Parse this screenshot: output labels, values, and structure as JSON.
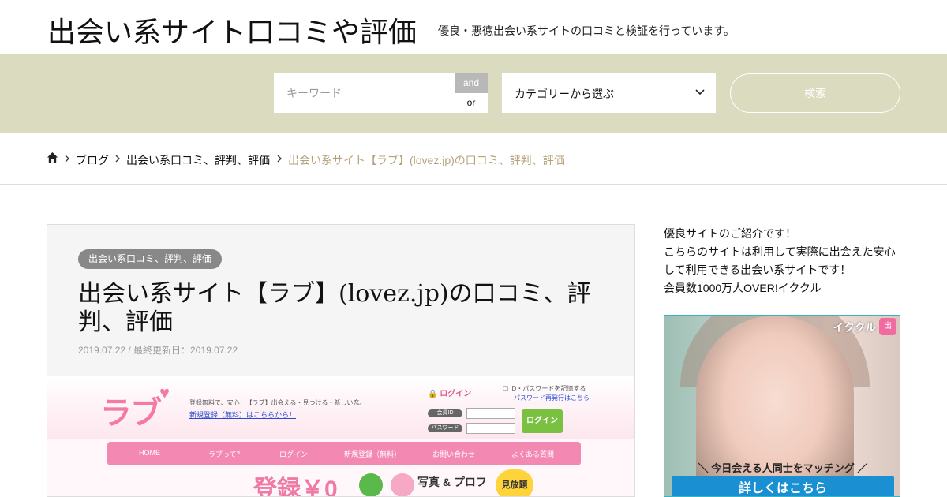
{
  "header": {
    "site_title": "出会い系サイト口コミや評価",
    "site_description": "優良・悪徳出会い系サイトの口コミと検証を行っています。"
  },
  "search": {
    "keyword_placeholder": "キーワード",
    "keyword_value": "",
    "and_label": "and",
    "or_label": "or",
    "category_selected": "カテゴリーから選ぶ",
    "search_button": "検索"
  },
  "breadcrumb": {
    "items": [
      "ブログ",
      "出会い系口コミ、評判、評価"
    ],
    "current": "出会い系サイト【ラブ】(lovez.jp)の口コミ、評判、評価"
  },
  "article": {
    "category_badge": "出会い系口コミ、評判、評価",
    "title": "出会い系サイト【ラブ】(lovez.jp)の口コミ、評判、評価",
    "date_line": "2019.07.22 / 最終更新日：2019.07.22"
  },
  "hero": {
    "logo": "ラブ",
    "tagline": "登録無料で、安心！【ラブ】出会える・見つける・新しい恋。",
    "register_link": "新規登録（無料）はこちらから！",
    "login_label": "ログイン",
    "remember_label": "ID・パスワードを記憶する",
    "password_reissue": "パスワード再発行はこちら",
    "member_id_label": "会員ID",
    "password_label": "パスワード",
    "login_button": "ログイン",
    "nav": [
      "HOME",
      "ラブって？",
      "ログイン",
      "新規登録（無料）",
      "お問い合わせ",
      "よくある質問"
    ],
    "reg_free": "登録￥0",
    "photo_profile": "写真 & プロフ",
    "unlimited": "見放題"
  },
  "sidebar": {
    "lines": [
      "優良サイトのご紹介です！",
      "こちらのサイトは利用して実際に出会えた安心",
      "して利用できる出会い系サイトです！",
      "会員数1000万人OVER!イククル"
    ],
    "ad": {
      "brand": "イククル",
      "brand_icon": "出",
      "caption": "＼ 今日会える人同士をマッチング ／",
      "button": "詳しくはこちら"
    }
  },
  "colors": {
    "search_band": "#dbdbbf",
    "breadcrumb_current": "#b5a27a",
    "accent_pink": "#f389b3",
    "ad_button": "#1a8fd1"
  }
}
